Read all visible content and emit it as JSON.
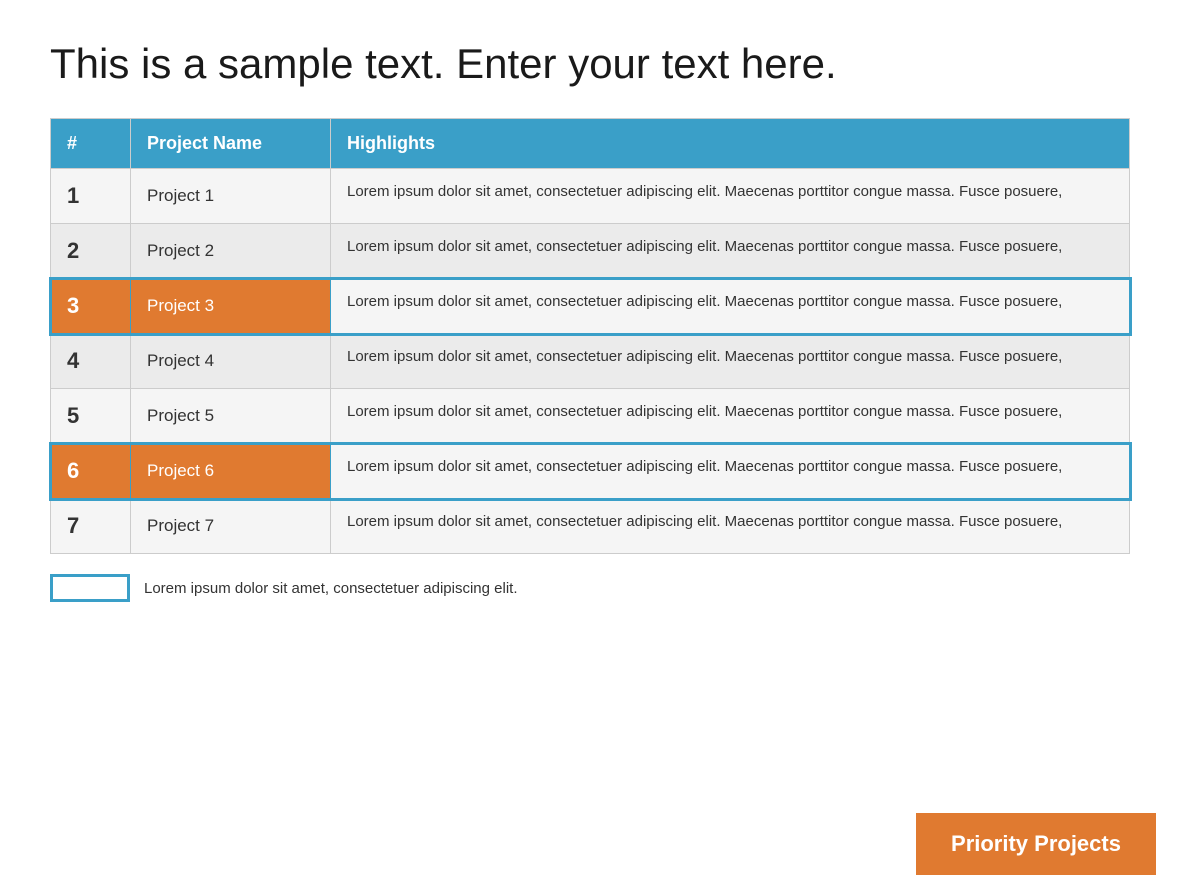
{
  "title": "This is a sample text. Enter your text here.",
  "table": {
    "headers": [
      "#",
      "Project Name",
      "Highlights"
    ],
    "rows": [
      {
        "num": "1",
        "name": "Project 1",
        "highlights": "Lorem ipsum dolor sit amet, consectetuer adipiscing elit. Maecenas porttitor congue massa. Fusce posuere,",
        "priority": false
      },
      {
        "num": "2",
        "name": "Project 2",
        "highlights": "Lorem ipsum dolor sit amet, consectetuer adipiscing elit. Maecenas porttitor congue massa. Fusce posuere,",
        "priority": false
      },
      {
        "num": "3",
        "name": "Project 3",
        "highlights": "Lorem ipsum dolor sit amet, consectetuer adipiscing elit. Maecenas porttitor congue massa. Fusce posuere,",
        "priority": true
      },
      {
        "num": "4",
        "name": "Project 4",
        "highlights": "Lorem ipsum dolor sit amet, consectetuer adipiscing elit. Maecenas porttitor congue massa. Fusce posuere,",
        "priority": false
      },
      {
        "num": "5",
        "name": "Project 5",
        "highlights": "Lorem ipsum dolor sit amet, consectetuer adipiscing elit. Maecenas porttitor congue massa. Fusce posuere,",
        "priority": false
      },
      {
        "num": "6",
        "name": "Project 6",
        "highlights": "Lorem ipsum dolor sit amet, consectetuer adipiscing elit. Maecenas porttitor congue massa. Fusce posuere,",
        "priority": true
      },
      {
        "num": "7",
        "name": "Project 7",
        "highlights": "Lorem ipsum dolor sit amet, consectetuer adipiscing elit. Maecenas porttitor congue massa. Fusce posuere,",
        "priority": false
      }
    ]
  },
  "legend": {
    "text": "Lorem ipsum dolor sit amet, consectetuer adipiscing elit."
  },
  "priority_button": {
    "label": "Priority Projects"
  },
  "colors": {
    "header_bg": "#3a9fc8",
    "priority_bg": "#e07a30",
    "outline": "#3a9fc8"
  }
}
